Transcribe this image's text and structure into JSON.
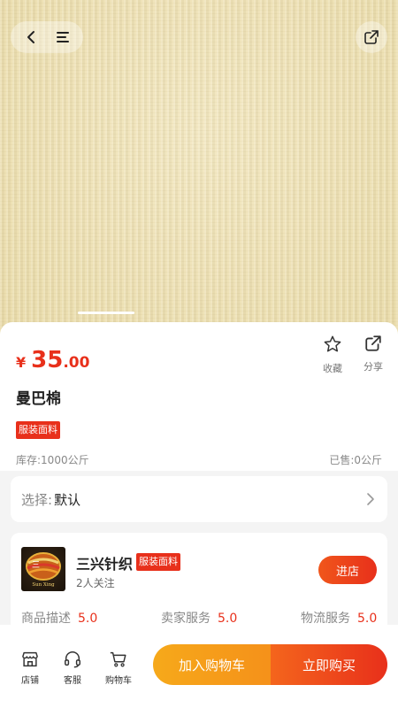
{
  "hero": {
    "slide_count": 1,
    "active_slide": 1
  },
  "product": {
    "price_symbol": "¥",
    "price_int": "35",
    "price_dec": ".00",
    "title": "曼巴棉",
    "tag": "服装面料",
    "stock": "库存:1000公斤",
    "sold": "已售:0公斤",
    "actions": {
      "favorite": "收藏",
      "share": "分享"
    }
  },
  "selection": {
    "label": "选择:",
    "value": "默认"
  },
  "shop": {
    "name": "三兴针织",
    "tag": "服装面料",
    "followers": "2人关注",
    "enter": "进店",
    "logo_text": "Sun Xing",
    "ratings": [
      {
        "label": "商品描述",
        "score": "5.0"
      },
      {
        "label": "卖家服务",
        "score": "5.0"
      },
      {
        "label": "物流服务",
        "score": "5.0"
      }
    ]
  },
  "bottom_bar": {
    "store": "店铺",
    "service": "客服",
    "cart": "购物车",
    "add_to_cart": "加入购物车",
    "buy_now": "立即购买"
  },
  "colors": {
    "accent": "#e8301b",
    "cart_button": "#f5a31a",
    "hero_fabric": "#efe2b5"
  },
  "icons": [
    "back-arrow-icon",
    "menu-icon",
    "share-icon",
    "star-icon",
    "chevron-right-icon",
    "store-icon",
    "headset-icon",
    "cart-icon"
  ]
}
